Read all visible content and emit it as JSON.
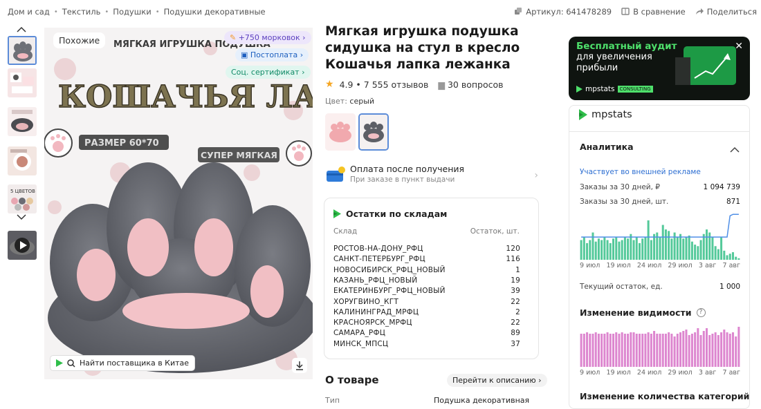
{
  "breadcrumb": [
    "Дом и сад",
    "Текстиль",
    "Подушки",
    "Подушки декоративные"
  ],
  "top_actions": {
    "article": "Артикул: 641478289",
    "compare": "В сравнение",
    "share": "Поделиться"
  },
  "gallery": {
    "similar_label": "Похожие",
    "badge_carrots": "+750 морковок",
    "badge_postpay": "Постоплата",
    "badge_cert": "Соц. сертификат",
    "find_supplier": "Найти поставщика в Китае",
    "image_text": {
      "top": "МЯГКАЯ ИГРУШКА ПОДУШКА",
      "title": "КОШАЧЬЯ ЛАПКА",
      "size": "РАЗМЕР 60*70",
      "soft": "СУПЕР МЯГКАЯ"
    },
    "thumb_texts": [
      "",
      "",
      "",
      "",
      "5 ЦВЕТОВ"
    ]
  },
  "product": {
    "title": "Мягкая игрушка подушка сидушка на стул в кресло Кошачья лапка лежанка",
    "rating": "4.9",
    "reviews": "7 555 отзывов",
    "questions": "30 вопросов",
    "color_label": "Цвет:",
    "color_value": "серый"
  },
  "payment": {
    "title": "Оплата после получения",
    "subtitle": "При заказе в пункт выдачи"
  },
  "stock": {
    "title": "Остатки по складам",
    "col_warehouse": "Склад",
    "col_qty": "Остаток, шт.",
    "rows": [
      {
        "name": "РОСТОВ-НА-ДОНУ_РФЦ",
        "qty": "120"
      },
      {
        "name": "САНКТ-ПЕТЕРБУРГ_РФЦ",
        "qty": "116"
      },
      {
        "name": "НОВОСИБИРСК_РФЦ_НОВЫЙ",
        "qty": "1"
      },
      {
        "name": "КАЗАНЬ_РФЦ_НОВЫЙ",
        "qty": "19"
      },
      {
        "name": "ЕКАТЕРИНБУРГ_РФЦ_НОВЫЙ",
        "qty": "39"
      },
      {
        "name": "ХОРУГВИНО_КГТ",
        "qty": "22"
      },
      {
        "name": "КАЛИНИНГРАД_МРФЦ",
        "qty": "2"
      },
      {
        "name": "КРАСНОЯРСК_МРФЦ",
        "qty": "22"
      },
      {
        "name": "САМАРА_РФЦ",
        "qty": "89"
      },
      {
        "name": "МИНСК_МПСЦ",
        "qty": "37"
      }
    ]
  },
  "about": {
    "title": "О товаре",
    "go_description": "Перейти к описанию",
    "type_label": "Тип",
    "type_value": "Подушка декоративная"
  },
  "banner": {
    "line1": "Бесплатный аудит",
    "line2": "для увеличения",
    "line3": "прибыли",
    "brand": "mpstats",
    "tag": "CONSULTING"
  },
  "analytics": {
    "brand": "mpstats",
    "section": "Аналитика",
    "ads": "Участвует во внешней рекламе",
    "orders_rub_label": "Заказы за 30 дней, ₽",
    "orders_rub": "1 094 739",
    "orders_qty_label": "Заказы за 30 дней, шт.",
    "orders_qty": "871",
    "axis_labels": [
      "9 июл",
      "19 июл",
      "24 июл",
      "29 июл",
      "3 авг",
      "7 авг"
    ],
    "current_stock_label": "Текущий остаток, ед.",
    "current_stock": "1 000",
    "visibility_title": "Изменение видимости",
    "visibility_help": "?",
    "categories_title": "Изменение количества категорий"
  },
  "orders_chart": {
    "type": "bar",
    "values": [
      26,
      30,
      22,
      26,
      36,
      24,
      28,
      26,
      30,
      26,
      22,
      28,
      30,
      24,
      26,
      30,
      28,
      34,
      26,
      30,
      22,
      28,
      30,
      52,
      26,
      34,
      36,
      30,
      46,
      40,
      38,
      28,
      36,
      30,
      34,
      28,
      30,
      32,
      24,
      20,
      18,
      26,
      34,
      40,
      36,
      30,
      18,
      14,
      30,
      12,
      6,
      8,
      10,
      4,
      2
    ],
    "line": [
      30,
      30,
      30,
      30,
      30,
      30,
      30,
      30,
      30,
      30,
      30,
      30,
      30,
      30,
      30,
      30,
      30,
      30,
      30,
      30,
      30,
      30,
      30,
      30,
      30,
      30,
      30,
      30,
      30,
      30,
      30,
      30,
      30,
      30,
      30,
      30,
      30,
      30,
      30,
      30,
      30,
      30,
      30,
      30,
      30,
      30,
      30,
      30,
      30,
      30,
      30,
      58,
      60,
      60,
      60
    ],
    "colors": {
      "bar": "#54c99a",
      "line": "#4f8fe6"
    }
  },
  "visibility_chart": {
    "type": "bar",
    "values": [
      48,
      48,
      50,
      48,
      48,
      50,
      48,
      48,
      48,
      50,
      48,
      48,
      50,
      48,
      50,
      48,
      48,
      50,
      50,
      48,
      48,
      48,
      48,
      50,
      48,
      52,
      48,
      48,
      48,
      48,
      50,
      48,
      44,
      48,
      50,
      52,
      54,
      46,
      48,
      50,
      56,
      46,
      52,
      56,
      46,
      48,
      50,
      46,
      50,
      54,
      50,
      48,
      50,
      44,
      58
    ],
    "colors": {
      "bar": "#dd86cf"
    }
  }
}
